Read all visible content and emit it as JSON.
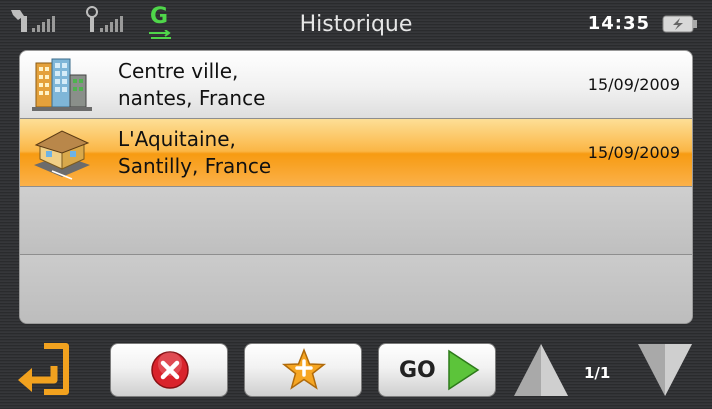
{
  "status": {
    "title": "Historique",
    "time": "14:35",
    "gprs_label": "G"
  },
  "history": [
    {
      "line1": "Centre ville,",
      "line2": "nantes, France",
      "date": "15/09/2009",
      "icon": "city-buildings-icon",
      "selected": false
    },
    {
      "line1": "L'Aquitaine,",
      "line2": "Santilly, France",
      "date": "15/09/2009",
      "icon": "house-icon",
      "selected": true
    }
  ],
  "toolbar": {
    "go_label": "GO",
    "page_indicator": "1/1"
  },
  "colors": {
    "selected_row": "#fbb14a",
    "cancel_red": "#d9232c",
    "go_green": "#5cc43a",
    "star_orange": "#f6a623"
  }
}
